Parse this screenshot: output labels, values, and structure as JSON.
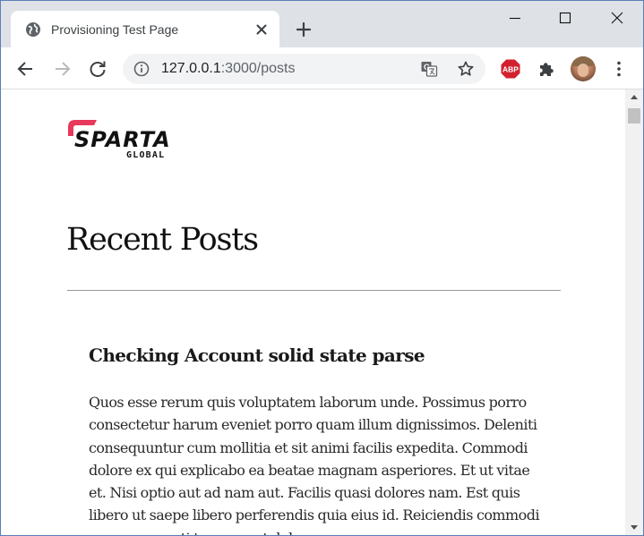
{
  "browser": {
    "tab": {
      "title": "Provisioning Test Page",
      "favicon": "globe-icon"
    },
    "new_tab_icon": "plus-icon",
    "window_controls": [
      "minimize-icon",
      "maximize-icon",
      "close-icon"
    ],
    "toolbar": {
      "back_icon": "arrow-left-icon",
      "forward_icon": "arrow-right-icon",
      "reload_icon": "reload-icon"
    },
    "address_bar": {
      "host": "127.0.0.1",
      "rest": ":3000/posts",
      "info_icon": "info-icon",
      "translate_icon": "translate-icon",
      "bookmark_icon": "star-icon"
    },
    "extensions": {
      "adblock_label": "ABP",
      "puzzle_icon": "puzzle-icon"
    },
    "menu_icon": "more-vertical-icon"
  },
  "page": {
    "logo": {
      "text": "SPARTA",
      "subtext": "GLOBAL",
      "accent_color": "#e8385c"
    },
    "heading": "Recent Posts",
    "posts": [
      {
        "title": "Checking Account solid state parse",
        "body": "Quos esse rerum quis voluptatem laborum unde. Possimus porro consectetur harum eveniet porro quam illum dignissimos. Deleniti consequuntur cum mollitia et sit animi facilis expedita. Commodi dolore ex qui explicabo ea beatae magnam asperiores. Et ut vitae et. Nisi optio aut ad nam aut. Facilis quasi dolores nam. Est quis libero ut saepe libero perferendis quia eius id. Reiciendis commodi rerum corrupti tempora et dolorum."
      }
    ]
  },
  "colors": {
    "tabstrip": "#dee1e6",
    "omnibox": "#f1f3f4",
    "abp_red": "#d2212e"
  }
}
